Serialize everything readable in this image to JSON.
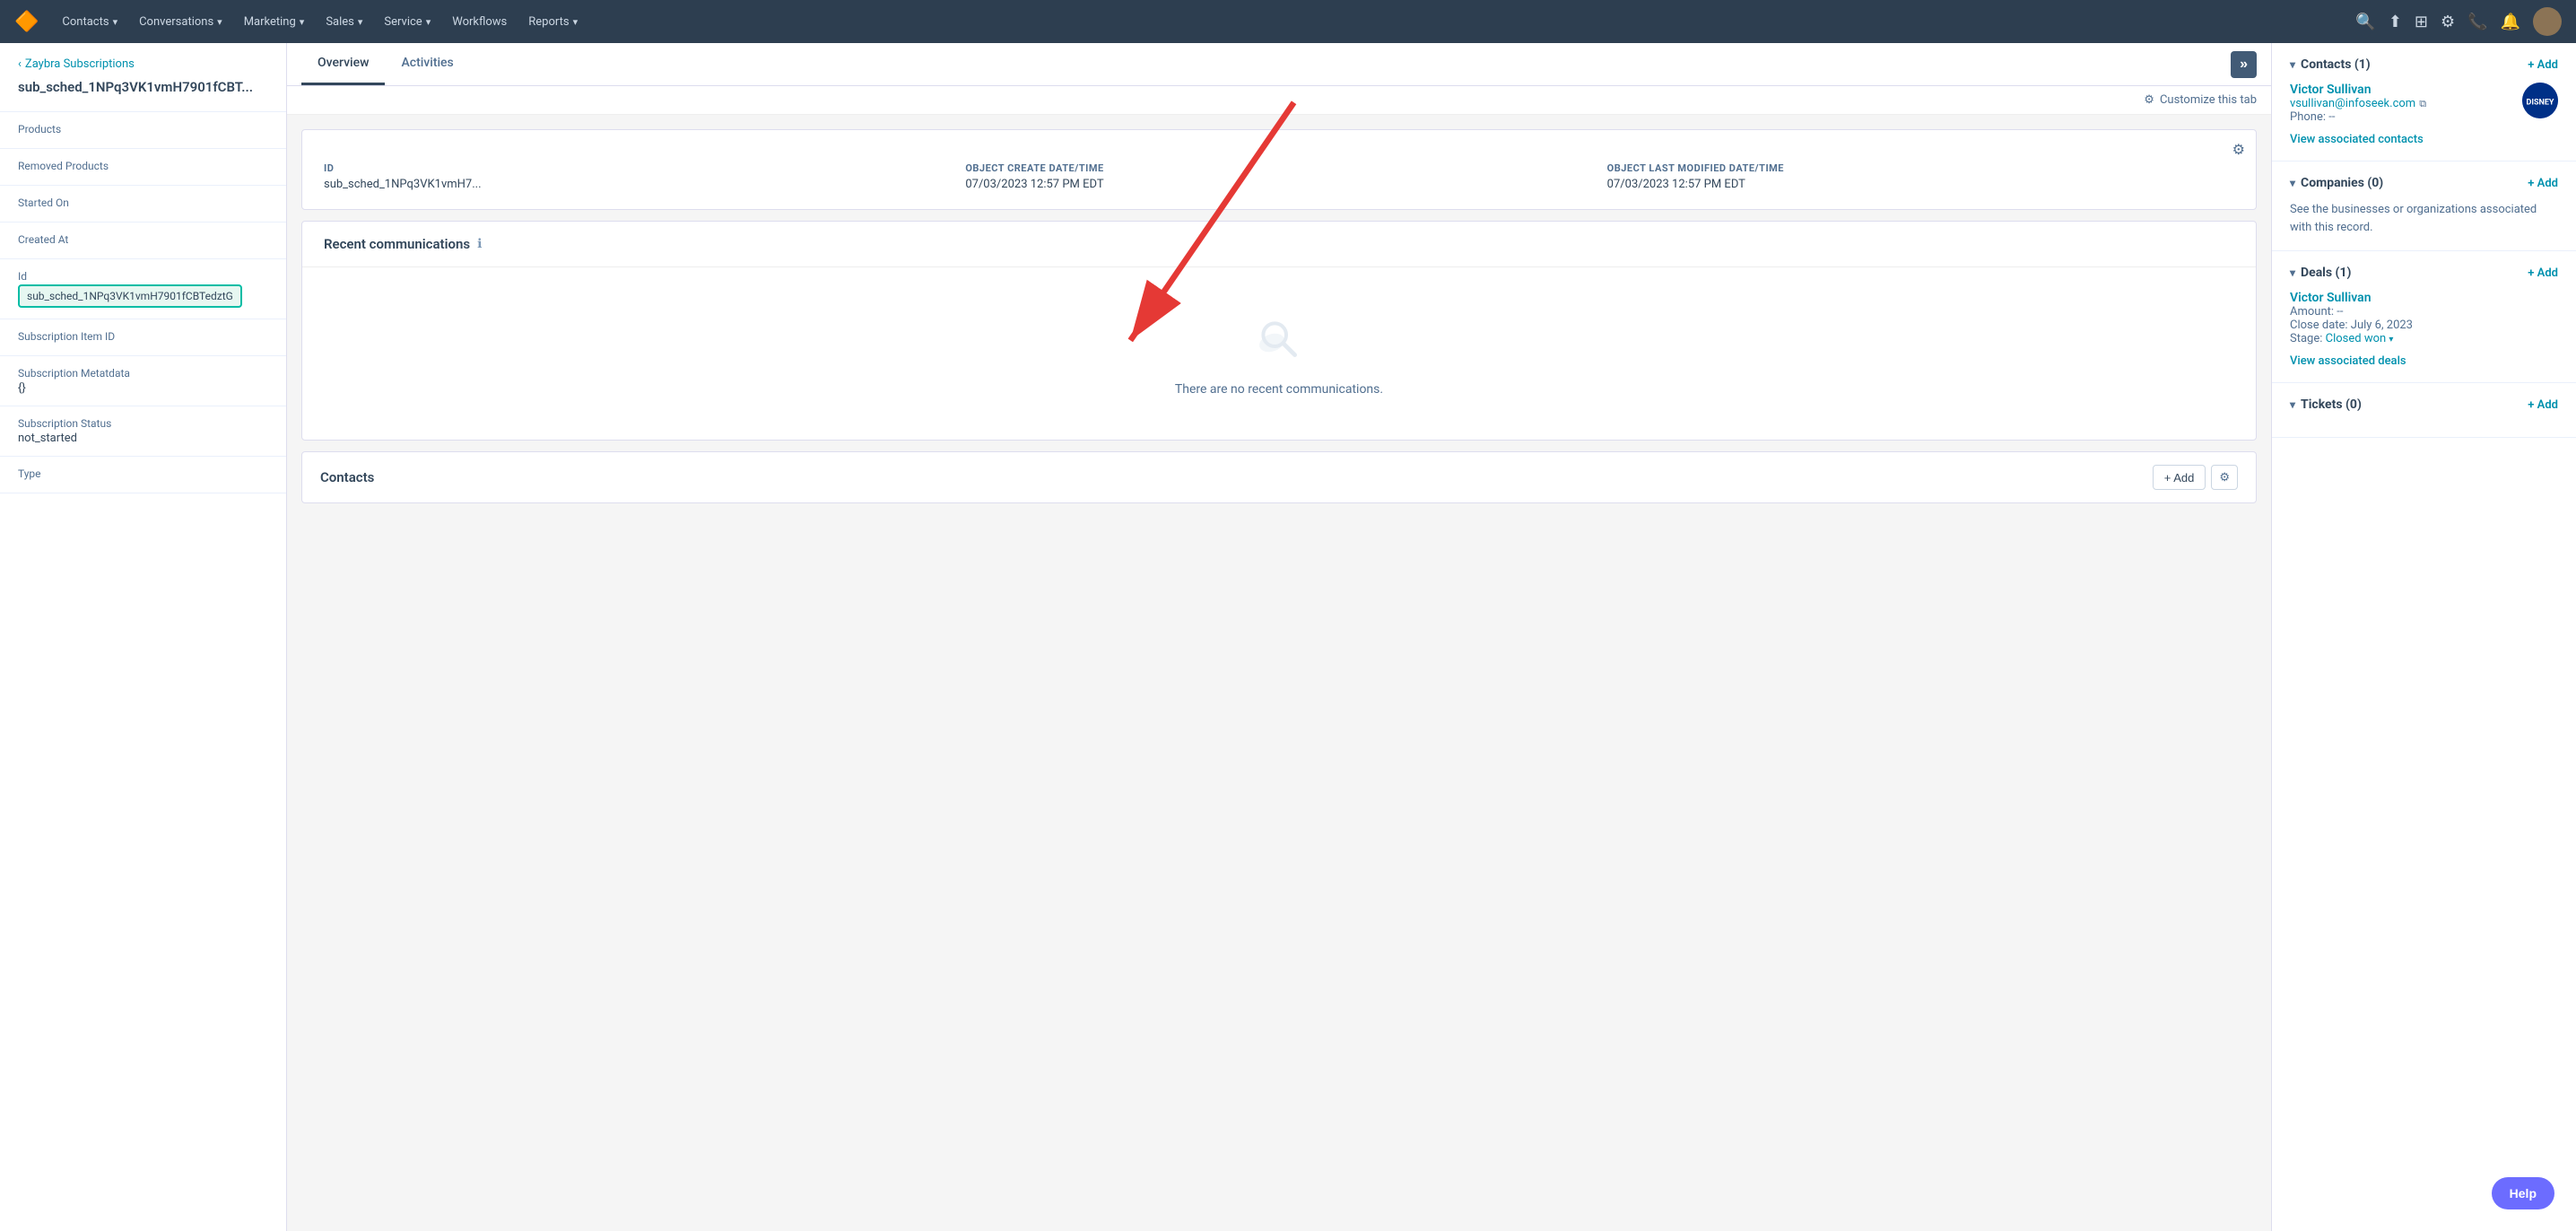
{
  "nav": {
    "logo": "🔶",
    "items": [
      {
        "label": "Contacts",
        "hasDropdown": true
      },
      {
        "label": "Conversations",
        "hasDropdown": true
      },
      {
        "label": "Marketing",
        "hasDropdown": true
      },
      {
        "label": "Sales",
        "hasDropdown": true
      },
      {
        "label": "Service",
        "hasDropdown": true
      },
      {
        "label": "Workflows",
        "hasDropdown": false
      },
      {
        "label": "Reports",
        "hasDropdown": true
      }
    ]
  },
  "sidebar": {
    "back_label": "Zaybra Subscriptions",
    "record_id": "sub_sched_1NPq3VK1vmH7901fCBT...",
    "properties": [
      {
        "label": "Products",
        "value": ""
      },
      {
        "label": "Removed Products",
        "value": ""
      },
      {
        "label": "Started On",
        "value": ""
      },
      {
        "label": "Created At",
        "value": ""
      },
      {
        "label": "Id",
        "value": "sub_sched_1NPq3VK1vmH7901fCBTedztG",
        "highlighted": true
      },
      {
        "label": "Subscription Item ID",
        "value": ""
      },
      {
        "label": "Subscription Metatdata",
        "value": "{}"
      },
      {
        "label": "Subscription Status",
        "value": "not_started"
      },
      {
        "label": "Type",
        "value": ""
      }
    ]
  },
  "tabs": [
    {
      "label": "Overview",
      "active": true
    },
    {
      "label": "Activities",
      "active": false
    }
  ],
  "customize_label": "Customize this tab",
  "info_card": {
    "gear_label": "⚙",
    "columns": [
      {
        "label": "ID",
        "value": "sub_sched_1NPq3VK1vmH7..."
      },
      {
        "label": "OBJECT CREATE DATE/TIME",
        "value": "07/03/2023 12:57 PM EDT"
      },
      {
        "label": "OBJECT LAST MODIFIED DATE/TIME",
        "value": "07/03/2023 12:57 PM EDT"
      }
    ]
  },
  "recent_comms": {
    "title": "Recent communications",
    "empty_text": "There are no recent communications."
  },
  "contacts_section": {
    "title": "Contacts",
    "add_label": "+ Add",
    "gear_label": "⚙"
  },
  "right_sidebar": {
    "contacts": {
      "title": "Contacts (1)",
      "add_label": "+ Add",
      "name": "Victor Sullivan",
      "email": "vsullivan@infoseek.com",
      "phone_label": "Phone:",
      "phone_value": "--",
      "view_link": "View associated contacts"
    },
    "companies": {
      "title": "Companies (0)",
      "add_label": "+ Add",
      "desc": "See the businesses or organizations associated with this record."
    },
    "deals": {
      "title": "Deals (1)",
      "add_label": "+ Add",
      "name": "Victor Sullivan",
      "amount_label": "Amount:",
      "amount_value": "--",
      "close_date_label": "Close date:",
      "close_date_value": "July 6, 2023",
      "stage_label": "Stage:",
      "stage_value": "Closed won",
      "view_link": "View associated deals"
    },
    "tickets": {
      "title": "Tickets (0)",
      "add_label": "+ Add"
    }
  },
  "help_label": "Help"
}
